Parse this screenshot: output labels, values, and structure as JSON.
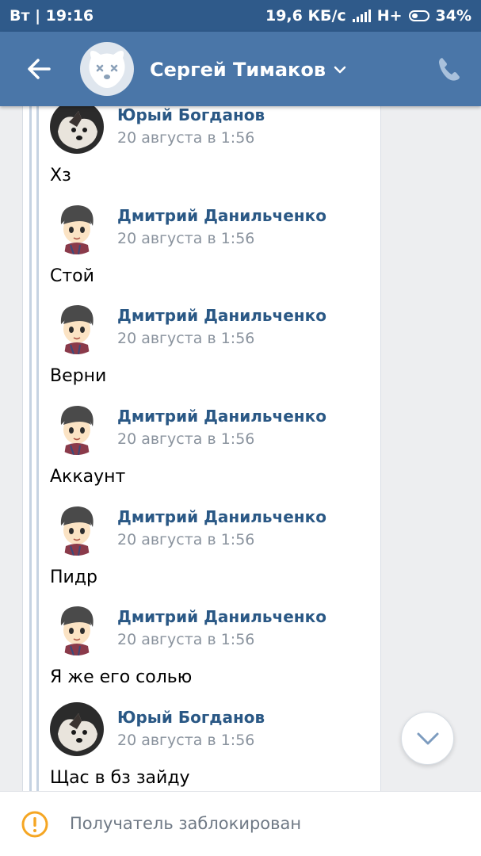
{
  "status_bar": {
    "time": "Вт | 19:16",
    "speed": "19,6 КБ/с",
    "network": "H+",
    "battery": "34%"
  },
  "header": {
    "title": "Сергей Тимаков",
    "back_icon": "arrow-left-icon",
    "call_icon": "phone-icon",
    "dropdown_icon": "chevron-down-icon"
  },
  "messages": [
    {
      "author": "Юрый Богданов",
      "date": "20 августа в 1:56",
      "text": "Хз",
      "avatar": "dog"
    },
    {
      "author": "Дмитрий Данильченко",
      "date": "20 августа в 1:56",
      "text": "Стой",
      "avatar": "cartoon"
    },
    {
      "author": "Дмитрий Данильченко",
      "date": "20 августа в 1:56",
      "text": "Верни",
      "avatar": "cartoon"
    },
    {
      "author": "Дмитрий Данильченко",
      "date": "20 августа в 1:56",
      "text": "Аккаунт",
      "avatar": "cartoon"
    },
    {
      "author": "Дмитрий Данильченко",
      "date": "20 августа в 1:56",
      "text": "Пидр",
      "avatar": "cartoon"
    },
    {
      "author": "Дмитрий Данильченко",
      "date": "20 августа в 1:56",
      "text": "Я же его солью",
      "avatar": "cartoon"
    },
    {
      "author": "Юрый Богданов",
      "date": "20 августа в 1:56",
      "text": "Щас в бз зайду",
      "avatar": "dog"
    }
  ],
  "bottom_bar": {
    "notice": "Получатель заблокирован",
    "icon": "warning-icon"
  },
  "colors": {
    "header_bg": "#4a76a8",
    "status_bg": "#2f5a8a",
    "link": "#2a5885",
    "warning": "#f5a623"
  }
}
